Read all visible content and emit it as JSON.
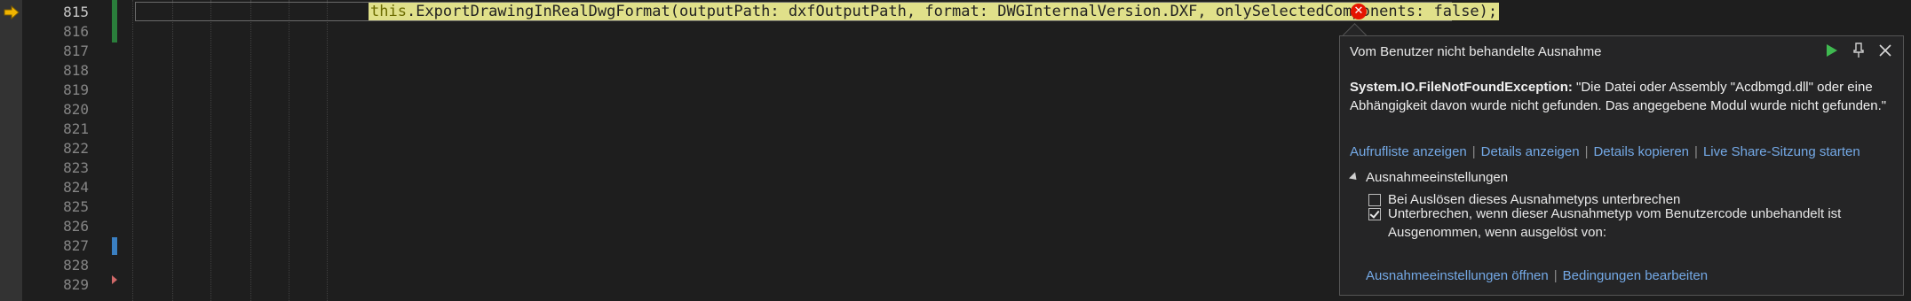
{
  "editor": {
    "line_numbers": [
      "815",
      "816",
      "817",
      "818",
      "819",
      "820",
      "821",
      "822",
      "823",
      "824",
      "825",
      "826",
      "827",
      "828",
      "829"
    ],
    "current_line": "815",
    "code_this": "this",
    "code_rest": ".ExportDrawingInRealDwgFormat(outputPath: dxfOutputPath, format: DWGInternalVersion.DXF, onlySelectedComponents: false);"
  },
  "exception_popup": {
    "title": "Vom Benutzer nicht behandelte Ausnahme",
    "exception_type": "System.IO.FileNotFoundException:",
    "message": " \"Die Datei oder Assembly \"Acdbmgd.dll\" oder eine Abhängigkeit davon wurde nicht gefunden. Das angegebene Modul wurde nicht gefunden.\"",
    "links": [
      "Aufrufliste anzeigen",
      "Details anzeigen",
      "Details kopieren",
      "Live Share-Sitzung starten"
    ],
    "settings_header": "Ausnahmeeinstellungen",
    "option_break_on_throw": {
      "label": "Bei Auslösen dieses Ausnahmetyps unterbrechen",
      "checked": false
    },
    "option_break_unhandled": {
      "label": "Unterbrechen, wenn dieser Ausnahmetyp vom Benutzercode unbehandelt ist",
      "checked": true
    },
    "option_except_label": "Ausgenommen, wenn ausgelöst von:",
    "bottom_links": [
      "Ausnahmeeinstellungen öffnen",
      "Bedingungen bearbeiten"
    ]
  },
  "colors": {
    "editor_bg": "#1e1e1e",
    "highlight": "#e0e08a",
    "error_red": "#e51400",
    "link_blue": "#74a9e6",
    "arrow_yellow": "#f0b400"
  },
  "icons": [
    "execution-pointer-icon",
    "error-icon",
    "continue-icon",
    "pin-icon",
    "close-icon",
    "collapse-triangle-icon"
  ]
}
